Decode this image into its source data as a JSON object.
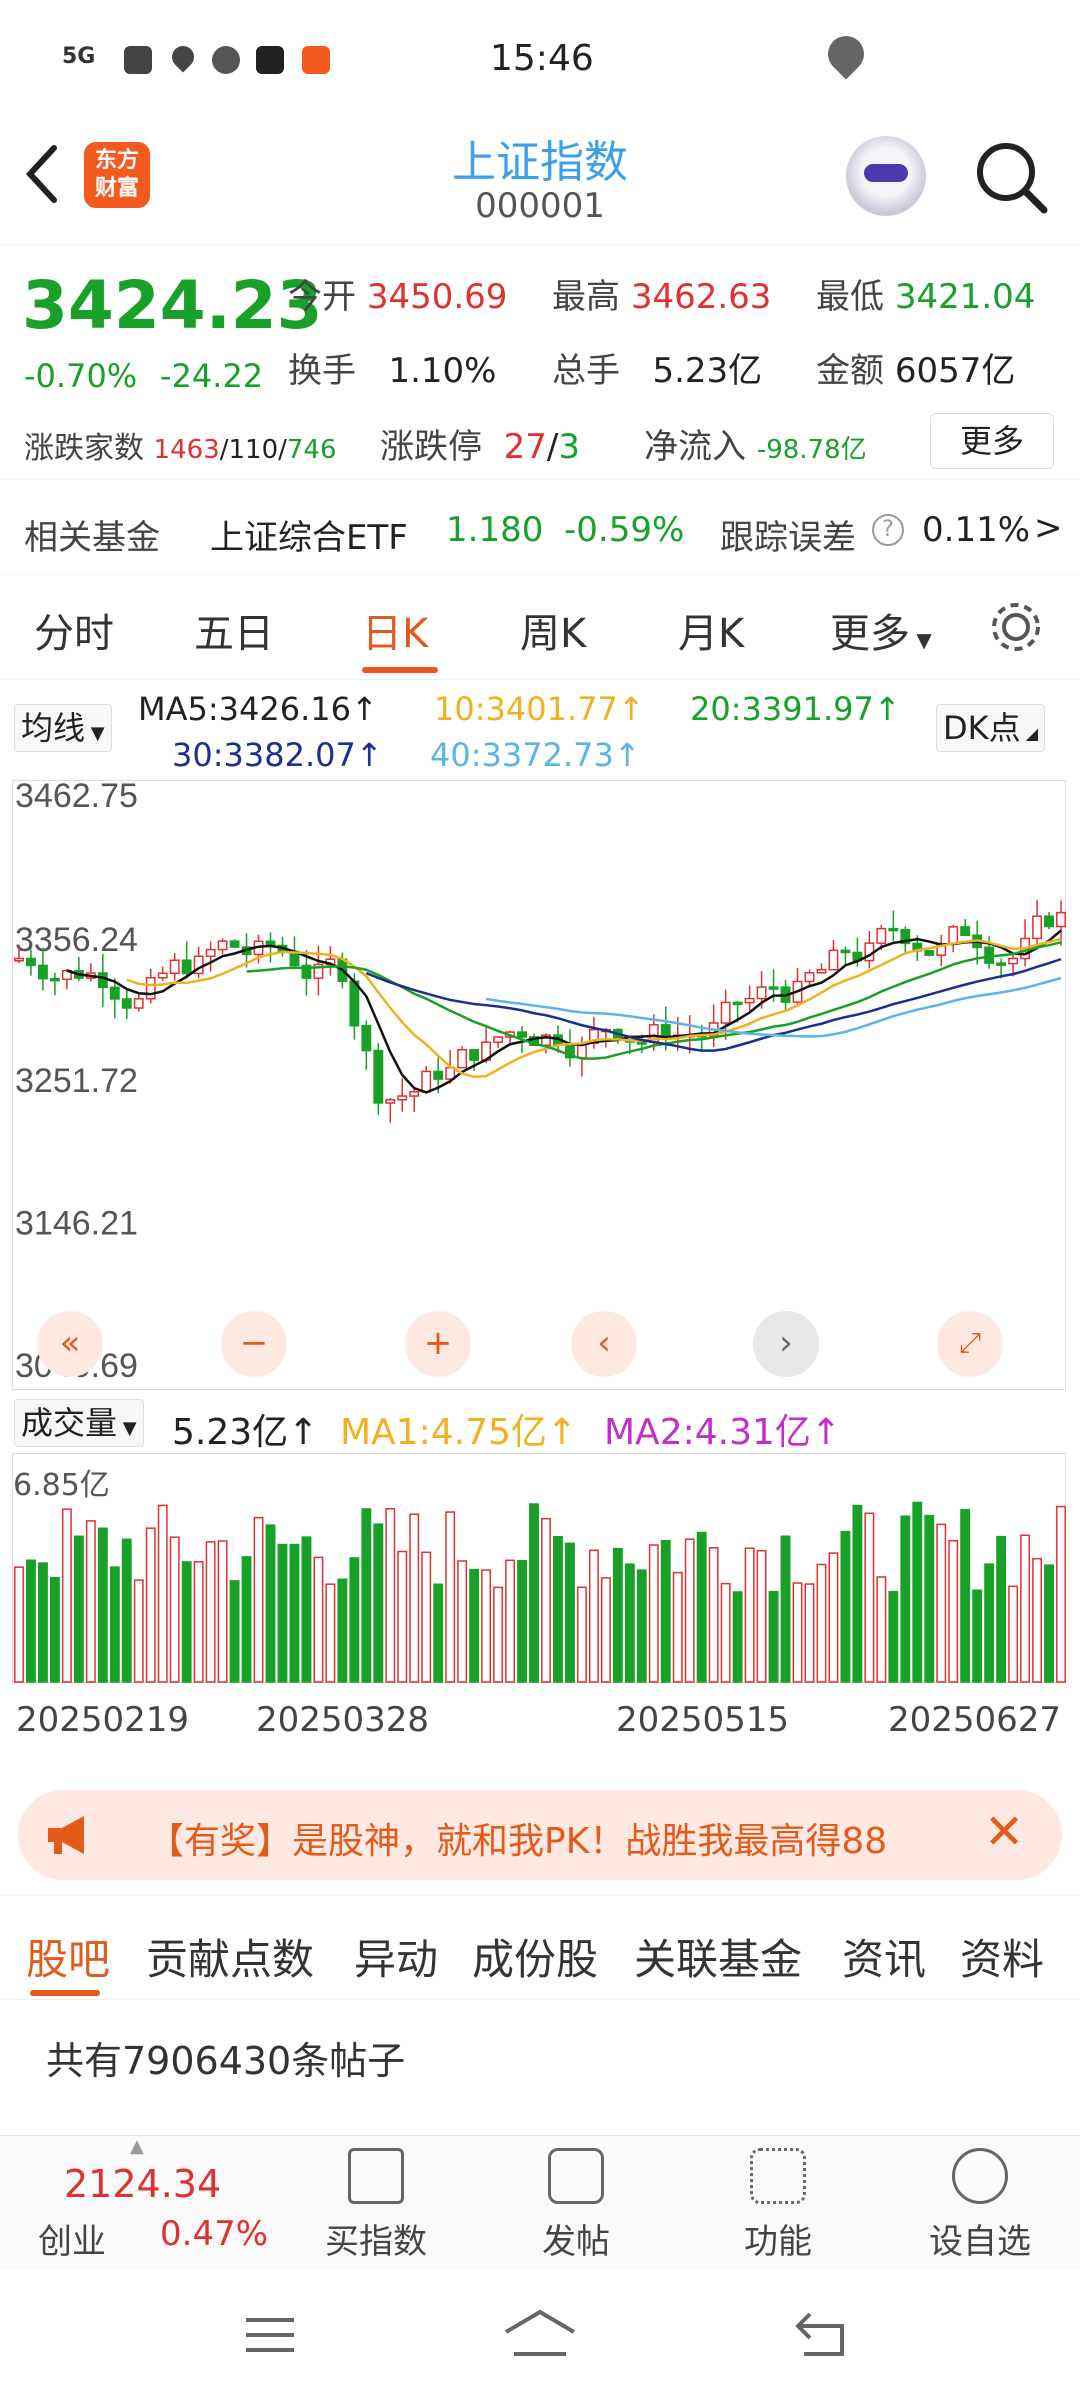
{
  "status": {
    "time": "15:46",
    "signal": "5G"
  },
  "header": {
    "title": "上证指数",
    "code": "000001",
    "logo": "东方\n财富"
  },
  "quote": {
    "price": "3424.23",
    "change_pct": "-0.70%",
    "change": "-24.22",
    "open_label": "今开",
    "open": "3450.69",
    "high_label": "最高",
    "high": "3462.63",
    "low_label": "最低",
    "low": "3421.04",
    "turnover_label": "换手",
    "turnover": "1.10%",
    "volume_label": "总手",
    "volume": "5.23亿",
    "amount_label": "金额",
    "amount": "6057亿",
    "breadth_label": "涨跌家数",
    "up": "1463",
    "flat": "110",
    "down": "746",
    "limit_label": "涨跌停",
    "limit_up": "27",
    "limit_down": "3",
    "netflow_label": "净流入",
    "netflow": "-98.78亿",
    "more": "更多"
  },
  "fund": {
    "label": "相关基金",
    "name": "上证综合ETF",
    "price": "1.180",
    "pct": "-0.59%",
    "err_label": "跟踪误差",
    "err": "0.11%"
  },
  "tabs": [
    "分时",
    "五日",
    "日K",
    "周K",
    "月K",
    "更多"
  ],
  "ma": {
    "selector": "均线",
    "ma5": "MA5:3426.16↑",
    "ma10": "10:3401.77↑",
    "ma20": "20:3391.97↑",
    "ma30": "30:3382.07↑",
    "ma40": "40:3372.73↑",
    "dk": "DK点"
  },
  "chart_data": {
    "type": "candlestick",
    "y_ticks": [
      "3462.75",
      "3356.24",
      "3251.72",
      "3146.21",
      "3040.69"
    ],
    "ylim": [
      3040.69,
      3462.75
    ],
    "colors": {
      "up": "#e03030",
      "down": "#19a028",
      "ma5": "#111111",
      "ma10": "#f0b020",
      "ma20": "#19a028",
      "ma30": "#1a2f90",
      "ma40": "#5ab4e8"
    },
    "x_labels": [
      "20250219",
      "20250328",
      "20250515",
      "20250627"
    ]
  },
  "volume": {
    "selector": "成交量",
    "vol": "5.23亿↑",
    "ma1": "MA1:4.75亿↑",
    "ma2": "MA2:4.31亿↑",
    "max": "6.85亿"
  },
  "banner": {
    "text": "【有奖】是股神，就和我PK！战胜我最高得88"
  },
  "forum_tabs": [
    "股吧",
    "贡献点数",
    "异动",
    "成份股",
    "关联基金",
    "资讯",
    "资料"
  ],
  "post_count": "共有7906430条帖子",
  "bottom": {
    "index_value": "2124.34",
    "index_name": "创业",
    "index_pct": "0.47%",
    "items": [
      "买指数",
      "发帖",
      "功能",
      "设自选"
    ]
  }
}
